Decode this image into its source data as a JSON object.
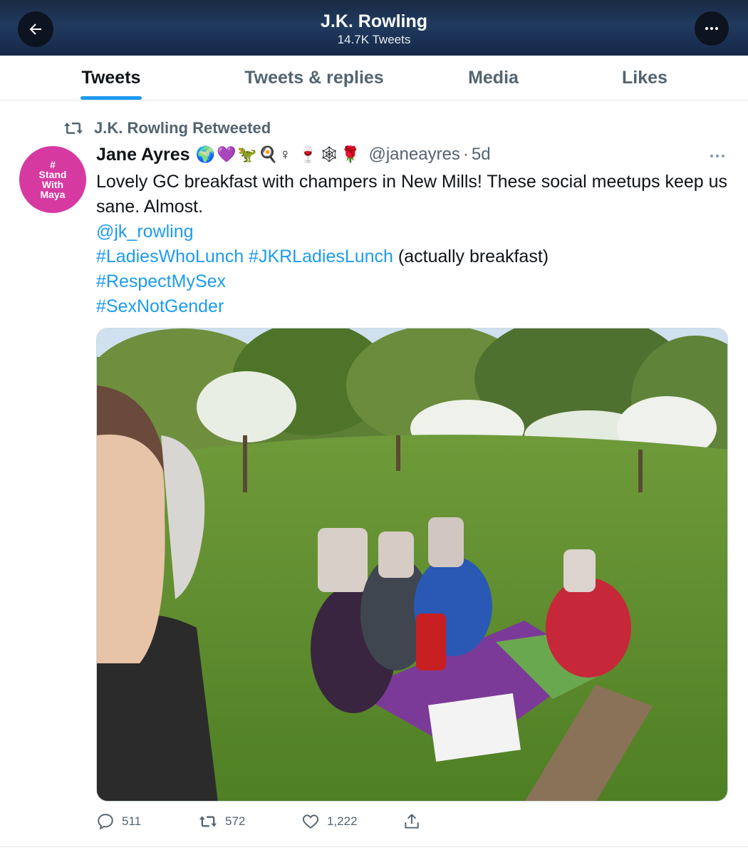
{
  "header": {
    "title": "J.K. Rowling",
    "subtitle": "14.7K Tweets"
  },
  "tabs": [
    {
      "label": "Tweets",
      "active": true
    },
    {
      "label": "Tweets & replies",
      "active": false
    },
    {
      "label": "Media",
      "active": false
    },
    {
      "label": "Likes",
      "active": false
    }
  ],
  "tweet": {
    "retweet_label": "J.K. Rowling Retweeted",
    "avatar_text": [
      "#",
      "Stand",
      "With",
      "Maya"
    ],
    "author_name": "Jane Ayres",
    "author_emojis": "🌍💜🦖🍳♀ 🍷🕸🌹",
    "author_handle": "@janeayres",
    "separator": "·",
    "time": "5d",
    "more_icon": "more-dots-icon",
    "text_line1": "Lovely GC breakfast with champers in New Mills! These social meetups keep us sane. Almost.",
    "mention": "@jk_rowling",
    "hashtag1": "#LadiesWhoLunch",
    "hashtag2": "#JKRLadiesLunch",
    "text_after_hashtags": " (actually breakfast)",
    "hashtag3": "#RespectMySex",
    "hashtag4": "#SexNotGender",
    "stats": {
      "replies": "511",
      "retweets": "572",
      "likes": "1,222"
    }
  },
  "colors": {
    "accent": "#1d9bf0",
    "avatar_bg": "#d63aa1",
    "muted": "#536471"
  }
}
